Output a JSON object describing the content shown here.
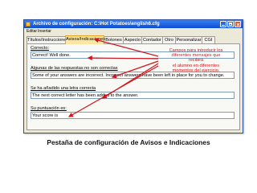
{
  "window": {
    "title": "Archivo de configuración: C:\\Hot Potatoes\\english6.cfg"
  },
  "menu": {
    "items": [
      "Editar",
      "Insertar"
    ]
  },
  "tabs": [
    {
      "label": "Títulos/Instrucciones",
      "active": false
    },
    {
      "label": "Avisos/Indicaciones",
      "active": true
    },
    {
      "label": "Botones",
      "active": false
    },
    {
      "label": "Aspecto",
      "active": false
    },
    {
      "label": "Contador",
      "active": false
    },
    {
      "label": "Otro",
      "active": false
    },
    {
      "label": "Personalizar",
      "active": false
    },
    {
      "label": "CGI",
      "active": false
    }
  ],
  "fields": [
    {
      "label": "Correcto:",
      "value": "Correct! Well done."
    },
    {
      "label": "Algunas de las respuestas no son correctas",
      "value": "Some of your answers are incorrect. Incorrect answers have been left in place for you to change."
    },
    {
      "label": "Se ha añadido una letra correcta",
      "value": "The next correct letter has been added to the answer."
    },
    {
      "label": "Su puntuación es:",
      "value": "Your score is"
    }
  ],
  "callout": {
    "lines": [
      "Campos para introducir los",
      "diferentes mensajes que recibirá",
      "el alumno en diferentes",
      "momentos del ejercicio."
    ]
  },
  "caption": "Pestaña de configuración de Avisos e Indicaciones",
  "colors": {
    "titlebar": "#0a4fd6",
    "active_tab": "#fde6a3",
    "callout_text": "#d4141c",
    "arrow": "#d4141c"
  }
}
